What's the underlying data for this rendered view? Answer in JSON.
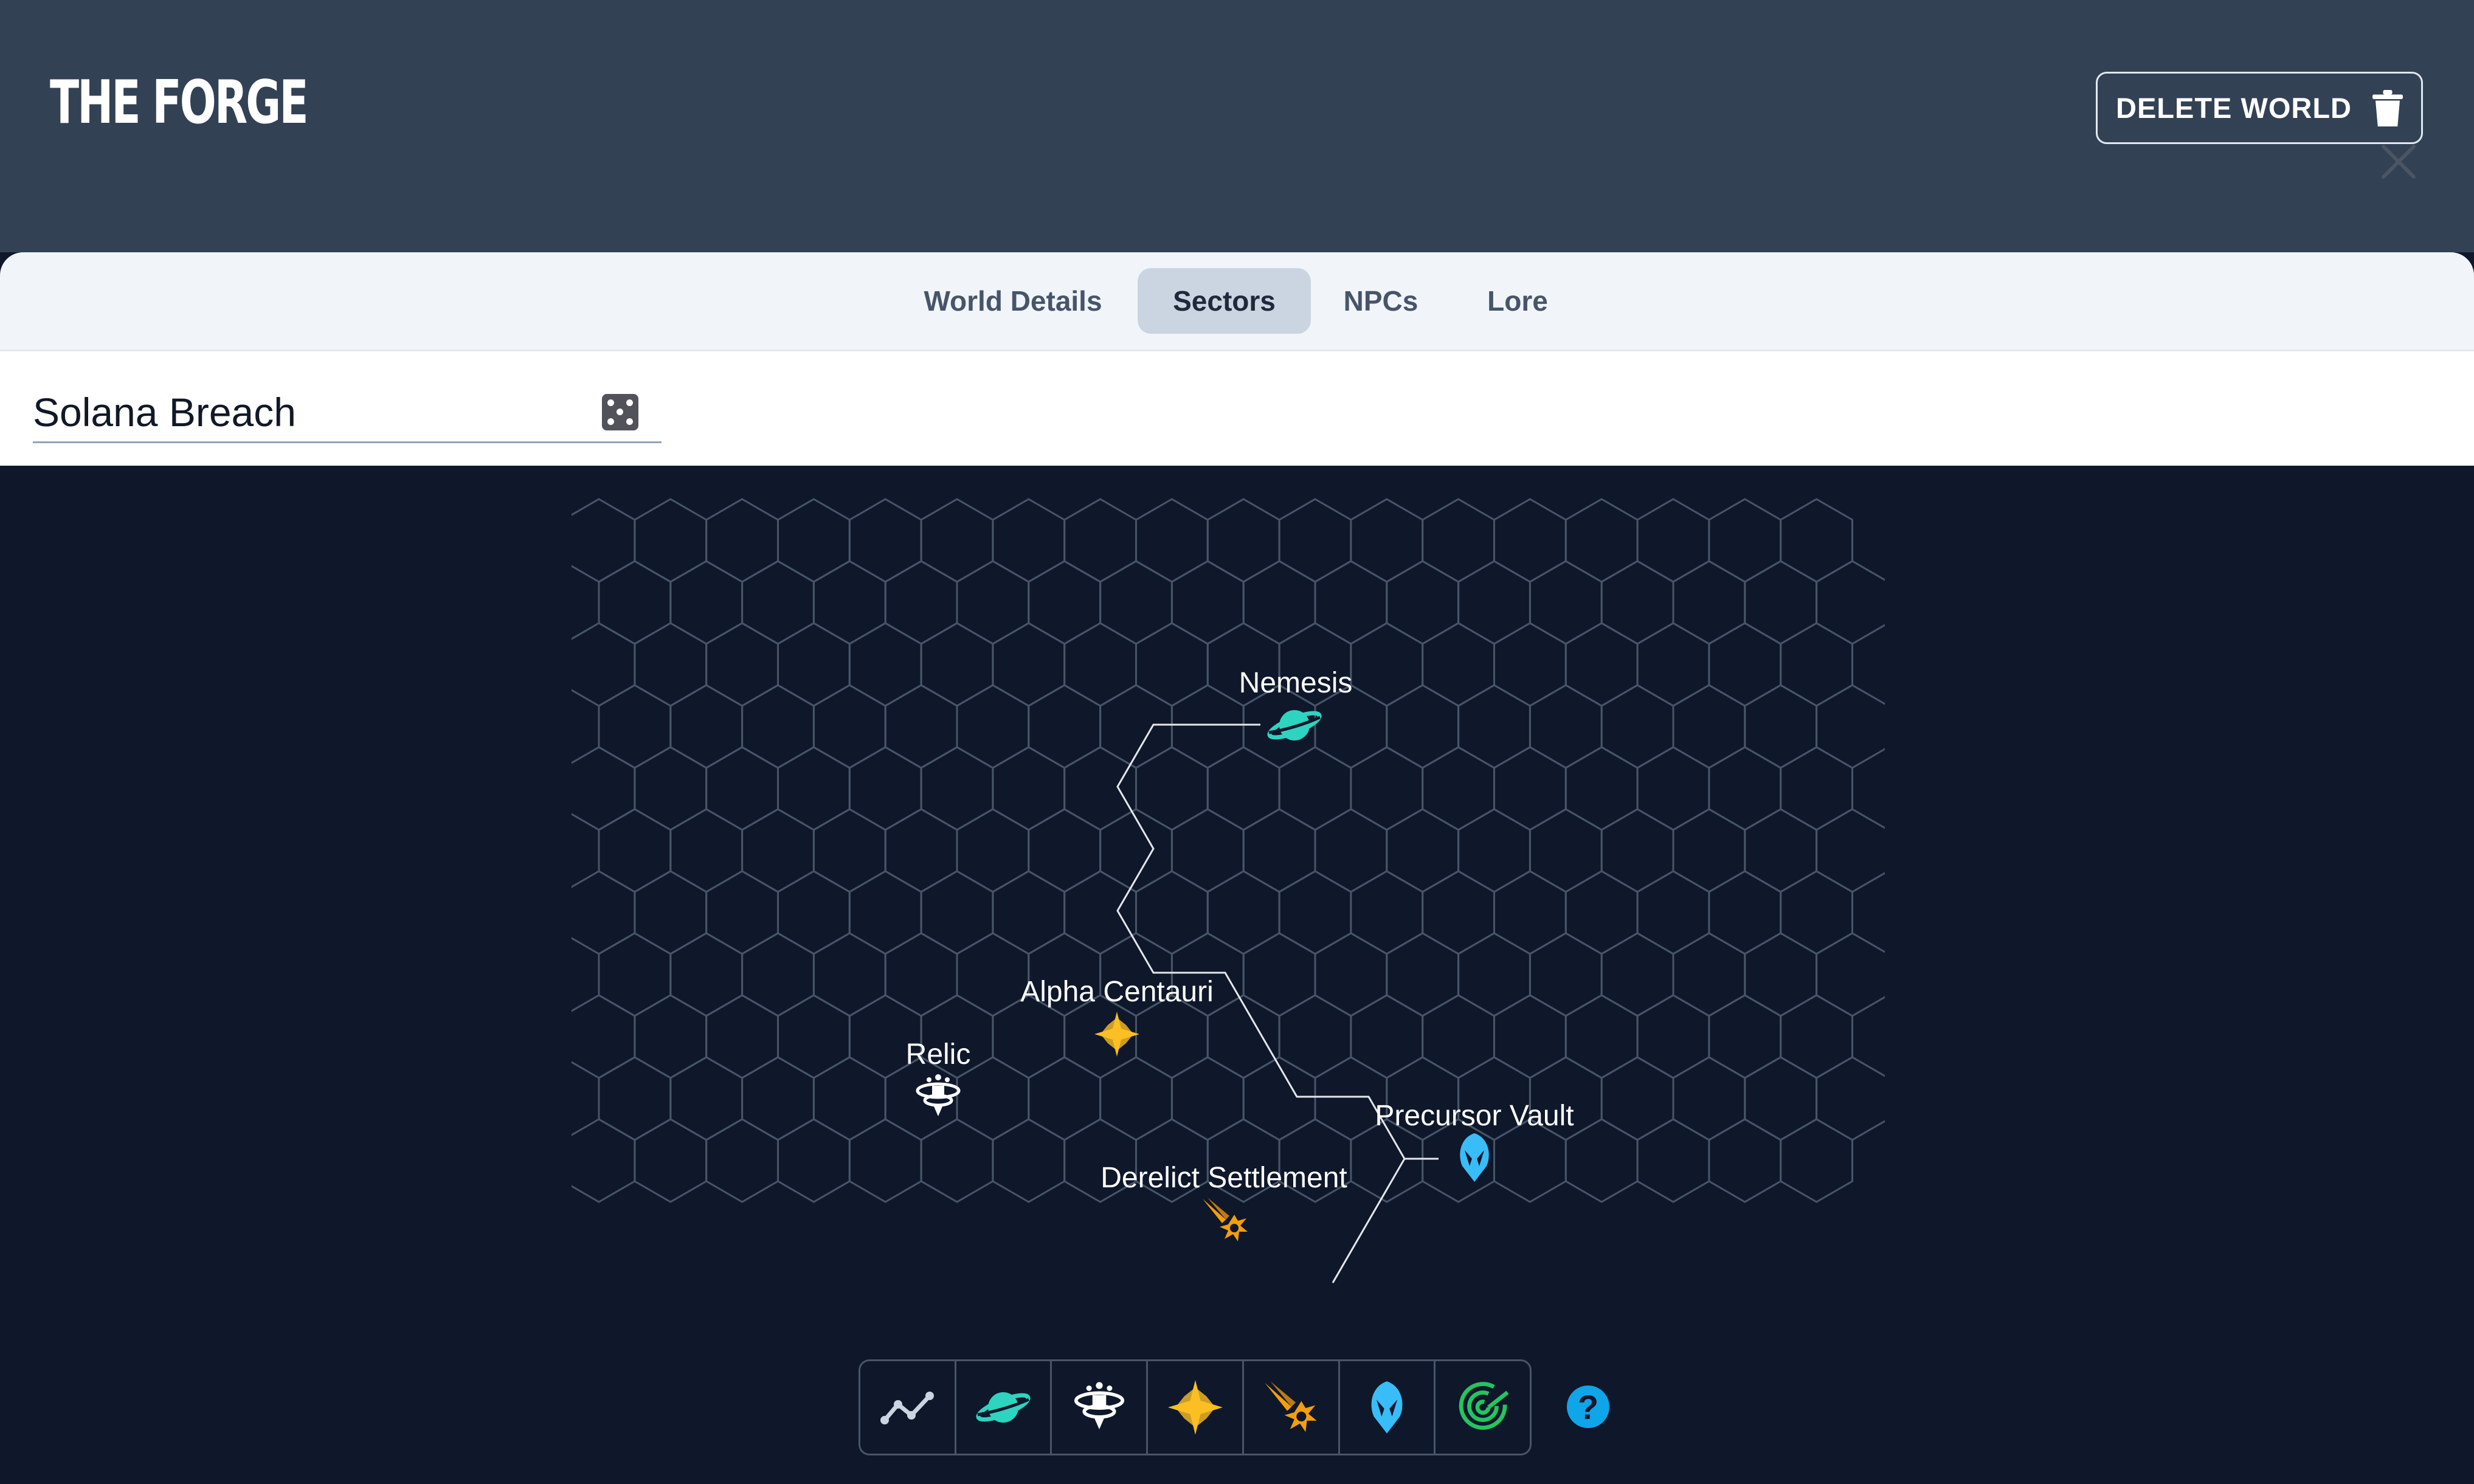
{
  "app": {
    "title": "THE FORGE"
  },
  "header": {
    "delete_label": "DELETE WORLD",
    "delete_icon": "trash-icon"
  },
  "tabs": [
    {
      "label": "World Details",
      "active": false
    },
    {
      "label": "Sectors",
      "active": true
    },
    {
      "label": "NPCs",
      "active": false
    },
    {
      "label": "Lore",
      "active": false
    }
  ],
  "sector": {
    "name": "Solana Breach",
    "randomize_icon": "dice-icon",
    "close_icon": "close-icon"
  },
  "map": {
    "locations": [
      {
        "label": "Nemesis",
        "icon": "planet-icon",
        "color": "#2dd4bf"
      },
      {
        "label": "Alpha Centauri",
        "icon": "star-icon",
        "color": "#fbbf24"
      },
      {
        "label": "Relic",
        "icon": "space-station-icon",
        "color": "#ffffff"
      },
      {
        "label": "Precursor Vault",
        "icon": "precursor-vault-icon",
        "color": "#38bdf8"
      },
      {
        "label": "Derelict Settlement",
        "icon": "derelict-icon",
        "color": "#f59e0b"
      }
    ]
  },
  "toolbar": {
    "tools": [
      {
        "name": "path-tool",
        "icon": "path-icon"
      },
      {
        "name": "planet-tool",
        "icon": "planet-icon"
      },
      {
        "name": "settlement-tool",
        "icon": "space-station-icon"
      },
      {
        "name": "star-tool",
        "icon": "star-icon"
      },
      {
        "name": "derelict-tool",
        "icon": "derelict-icon"
      },
      {
        "name": "vault-tool",
        "icon": "precursor-vault-icon"
      },
      {
        "name": "creature-tool",
        "icon": "spiral-icon"
      }
    ],
    "help_label": "?"
  },
  "colors": {
    "header_bg": "#334155",
    "map_bg": "#0f172a",
    "hex_stroke": "#475569",
    "path": "#e5e7eb"
  }
}
